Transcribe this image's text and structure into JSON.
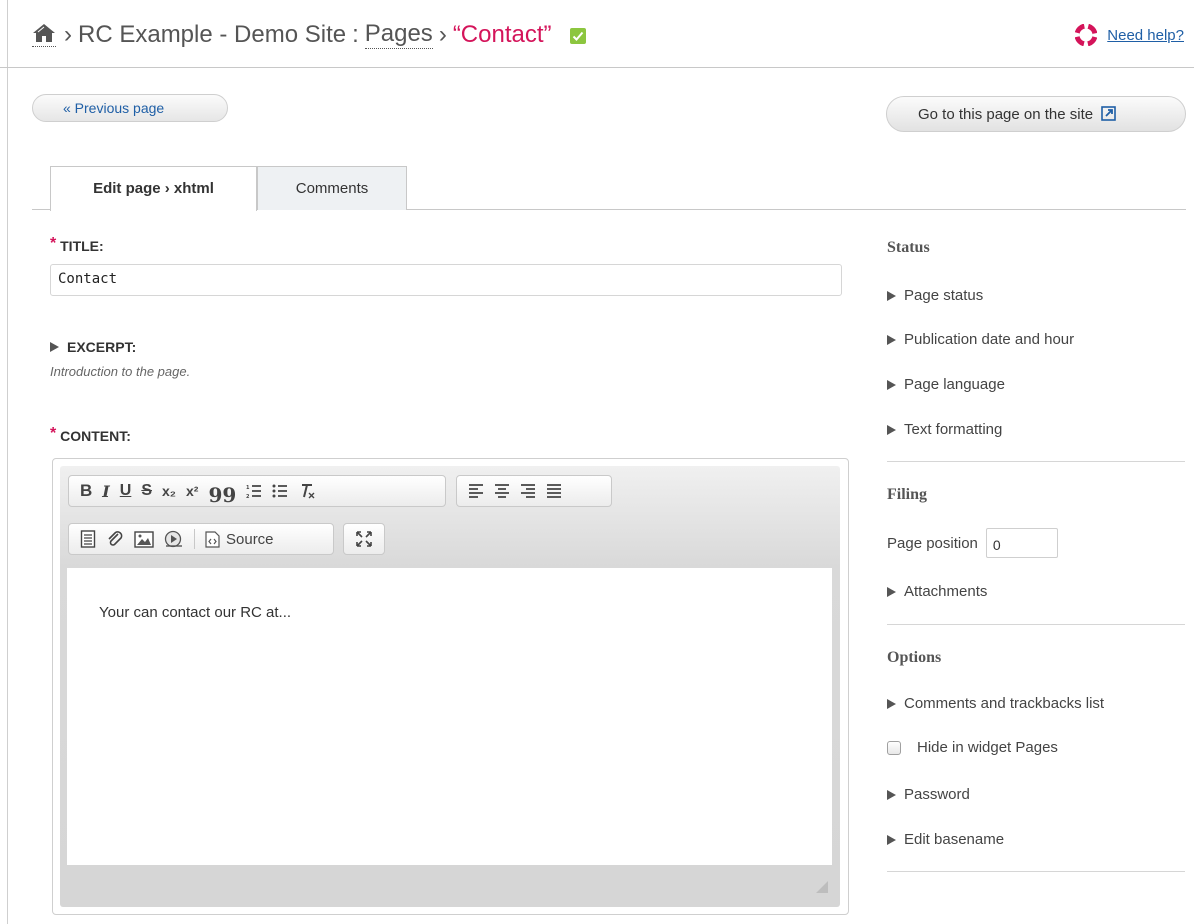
{
  "header": {
    "site_name": "RC Example - Demo Site",
    "sep1": "›",
    "colon": ":",
    "pages_link": "Pages",
    "sep2": "›",
    "current": "“Contact”",
    "help": "Need help?"
  },
  "nav": {
    "previous": "« Previous page",
    "goto": "Go to this page on the site"
  },
  "tabs": [
    {
      "label": "Edit page › xhtml",
      "active": true
    },
    {
      "label": "Comments",
      "active": false
    }
  ],
  "form": {
    "title_req": "*",
    "title_label": "TITLE:",
    "title_value": "Contact",
    "excerpt_label": "EXCERPT:",
    "excerpt_help": "Introduction to the page.",
    "content_req": "*",
    "content_label": "CONTENT:",
    "content_text": "Your can contact our RC at..."
  },
  "editor": {
    "toolbar_row1_group1": [
      "B",
      "I",
      "U",
      "S",
      "x₂",
      "x²",
      "99"
    ],
    "source_label": "Source"
  },
  "sidebar": {
    "status": {
      "heading": "Status",
      "items": [
        "Page status",
        "Publication date and hour",
        "Page language",
        "Text formatting"
      ]
    },
    "filing": {
      "heading": "Filing",
      "position_label": "Page position",
      "position_value": "0",
      "attachments": "Attachments"
    },
    "options": {
      "heading": "Options",
      "comments": "Comments and trackbacks list",
      "hide_widget": "Hide in widget Pages",
      "password": "Password",
      "basename": "Edit basename"
    }
  },
  "colors": {
    "accent_link": "#1f5fa6",
    "current_crumb": "#d4145a",
    "check_green": "#8cc63f"
  }
}
